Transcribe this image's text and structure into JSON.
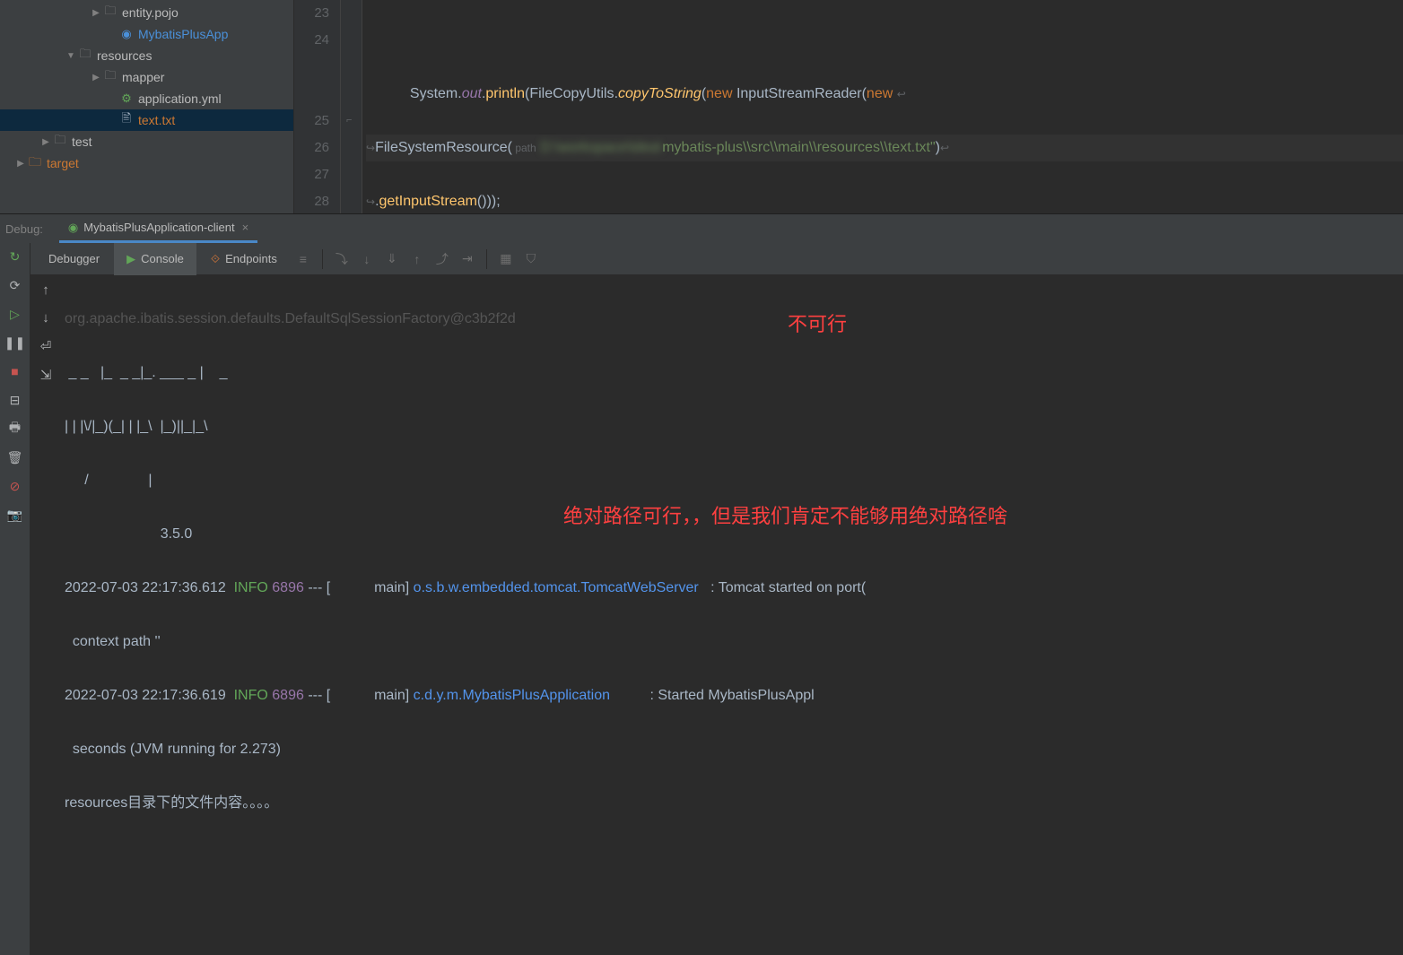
{
  "tree": {
    "entity": "entity.pojo",
    "app": "MybatisPlusApp",
    "resources": "resources",
    "mapper": "mapper",
    "appyml": "application.yml",
    "texttxt": "text.txt",
    "test": "test",
    "target": "target"
  },
  "lines": [
    "23",
    "24",
    "25",
    "26",
    "27",
    "28"
  ],
  "code": {
    "system": "System",
    "out": "out",
    "println": "println",
    "filecopy": "FileCopyUtils",
    "copytostring": "copyToString",
    "new1": "new",
    "isr": "InputStreamReader",
    "new2": "new",
    "fsr": "FileSystemResource",
    "pathlbl": " path",
    "blurred": "D:\\workspace\\idea\\",
    "rest": "mybatis-plus\\\\src\\\\main\\\\resources\\\\text.txt\"",
    "getinput": "getInputStream",
    "tail": "()));",
    "brace1": "}",
    "brace2": "}"
  },
  "debug": {
    "label": "Debug:",
    "tabname": "MybatisPlusApplication-client",
    "tabs": {
      "debugger": "Debugger",
      "console": "Console",
      "endpoints": "Endpoints"
    }
  },
  "console": {
    "l0": "org.apache.ibatis.session.defaults.DefaultSqlSessionFactory@c3b2f2d",
    "l1": " _ _   |_  _ _|_. ___ _ |    _",
    "l2": "| | |\\/|_)(_| | |_\\  |_)||_|_\\",
    "l3": "     /               |",
    "l4": "                        3.5.0",
    "ts1": "2022-07-03 22:17:36.612",
    "inf": "INFO",
    "pid": "6896",
    "dash": " --- [           main] ",
    "log1": "o.s.b.w.embedded.tomcat.TomcatWebServer",
    "msg1": "   : Tomcat started on port(",
    "ctx": "  context path ''",
    "ts2": "2022-07-03 22:17:36.619",
    "log2": "c.d.y.m.MybatisPlusApplication",
    "msg2": "          : Started MybatisPlusAppl",
    "jvm": "  seconds (JVM running for 2.273)",
    "res": "resources目录下的文件内容。。。。"
  },
  "annot": {
    "a1": "不可行",
    "a2": "绝对路径可行，，但是我们肯定不能够用绝对路径啥"
  }
}
